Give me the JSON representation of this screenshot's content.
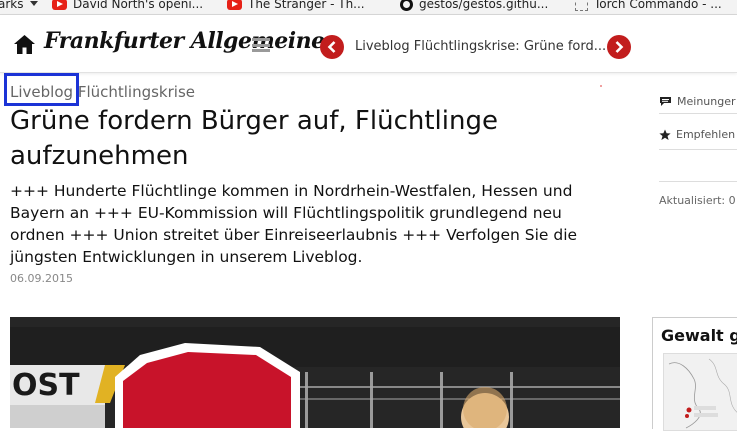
{
  "bookmarks": [
    {
      "label": "arks",
      "icon": "chevron-down-icon"
    },
    {
      "label": "David North's openi...",
      "icon": "youtube-icon"
    },
    {
      "label": "The Stranger - Th...",
      "icon": "youtube-icon"
    },
    {
      "label": "gestos/gestos.githu...",
      "icon": "github-icon"
    },
    {
      "label": "Torch Commando - ...",
      "icon": "page-icon"
    }
  ],
  "header": {
    "logo": "Frankfurter Allgemeine",
    "nav_title": "Liveblog Flüchtlingskrise: Grüne ford..."
  },
  "article": {
    "kicker_label": "Liveblog",
    "kicker_topic": "Flüchtlingskrise",
    "headline": "Grüne fordern Bürger auf, Flüchtlinge aufzunehmen",
    "teaser": "+++ Hunderte Flüchtlinge kommen in Nordrhein-Westfalen, Hessen und Bayern an +++ EU-Kommission will Flüchtlingspolitik grundlegend neu ordnen +++ Union streitet über Einreiseerlaubnis +++ Verfolgen Sie die jüngsten Entwicklungen in unserem Liveblog.",
    "date": "06.09.2015"
  },
  "rail": {
    "comments_label": "Meinunger",
    "recommend_label": "Empfehlen",
    "updated_label": "Aktualisiert: 0"
  },
  "widget": {
    "title": "Gewalt ge"
  },
  "colors": {
    "accent": "#c21d1d",
    "highlight_box": "#1b33d6"
  }
}
